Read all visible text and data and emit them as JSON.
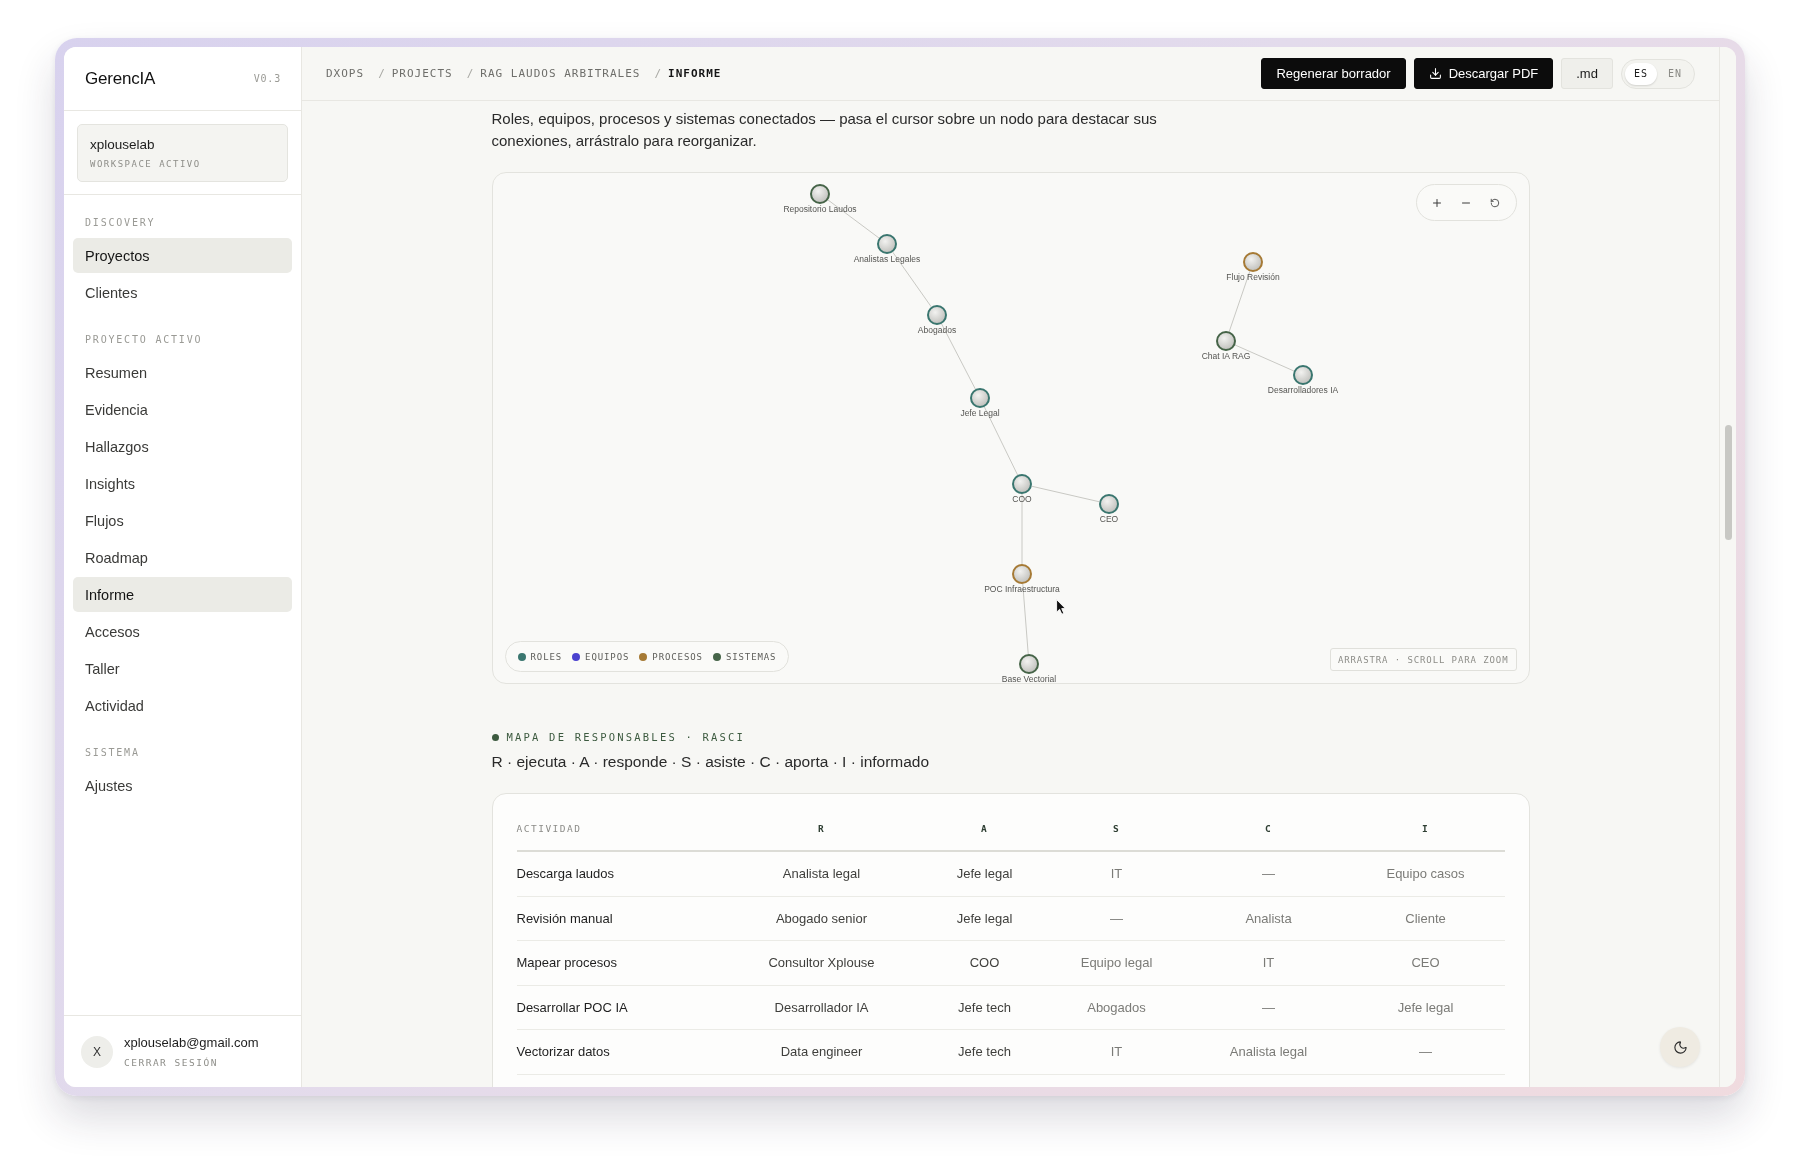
{
  "sidebar": {
    "brand": "GerencIA",
    "version": "V0.3",
    "workspace": {
      "name": "xplouselab",
      "caption": "WORKSPACE ACTIVO"
    },
    "sections": [
      {
        "title": "DISCOVERY",
        "items": [
          {
            "label": "Proyectos",
            "selected": true
          },
          {
            "label": "Clientes",
            "selected": false
          }
        ]
      },
      {
        "title": "PROYECTO ACTIVO",
        "items": [
          {
            "label": "Resumen",
            "selected": false
          },
          {
            "label": "Evidencia",
            "selected": false
          },
          {
            "label": "Hallazgos",
            "selected": false
          },
          {
            "label": "Insights",
            "selected": false
          },
          {
            "label": "Flujos",
            "selected": false
          },
          {
            "label": "Roadmap",
            "selected": false
          },
          {
            "label": "Informe",
            "selected": true
          },
          {
            "label": "Accesos",
            "selected": false
          },
          {
            "label": "Taller",
            "selected": false
          },
          {
            "label": "Actividad",
            "selected": false
          }
        ]
      },
      {
        "title": "SISTEMA",
        "items": [
          {
            "label": "Ajustes",
            "selected": false
          }
        ]
      }
    ],
    "user": {
      "initial": "X",
      "email": "xplouselab@gmail.com",
      "logout": "CERRAR SESIÓN"
    }
  },
  "topbar": {
    "breadcrumbs": [
      {
        "label": "DXOPS",
        "current": false
      },
      {
        "separator": "/",
        "label": "PROJECTS",
        "current": false
      },
      {
        "separator": "/",
        "label": "RAG LAUDOS ARBITRALES",
        "current": false
      },
      {
        "separator": "/",
        "label": "INFORME",
        "current": true
      }
    ],
    "actions": [
      {
        "label": "Regenerar borrador",
        "kind": "primary"
      },
      {
        "label": "Descargar PDF",
        "kind": "download"
      },
      {
        "label": ".md",
        "kind": "secondary"
      }
    ],
    "languages": [
      {
        "label": "ES",
        "selected": true
      },
      {
        "label": "EN",
        "selected": false
      }
    ]
  },
  "graph": {
    "description": "Roles, equipos, procesos y sistemas conectados — pasa el cursor sobre un nodo para destacar sus conexiones, arrástralo para reorganizar.",
    "nodes": [
      {
        "label": "Repositorio Laudos",
        "color": "#466448",
        "children": [
          {
            "label": "Analistas Legales",
            "color": "#3a766f",
            "children": [
              {
                "label": "Abogados",
                "color": "#3a766f",
                "children": [
                  {
                    "label": "Jefe Legal",
                    "color": "#3a766f",
                    "children": [
                      {
                        "label": "COO",
                        "color": "#3a766f",
                        "children": [
                          {
                            "label": "CEO",
                            "color": "#3a766f"
                          },
                          {
                            "label": "POC Infraestructura",
                            "color": "#a67a35",
                            "children": [
                              {
                                "label": "Base Vectorial",
                                "color": "#466448"
                              }
                            ]
                          }
                        ]
                      }
                    ]
                  }
                ]
              }
            ]
          }
        ]
      },
      {
        "label": "Flujo Revisión",
        "color": "#a67a35",
        "children": [
          {
            "label": "Chat IA RAG",
            "color": "#466448",
            "children": [
              {
                "label": "Desarrolladores IA",
                "color": "#3a766f"
              }
            ]
          }
        ]
      }
    ],
    "legend": [
      {
        "label": "ROLES",
        "color": "#3a766f"
      },
      {
        "label": "EQUIPOS",
        "color": "#4b42cf"
      },
      {
        "label": "PROCESOS",
        "color": "#a67a35"
      },
      {
        "label": "SISTEMAS",
        "color": "#466448"
      }
    ],
    "hint": "ARRASTRA · SCROLL PARA ZOOM"
  },
  "rasci": {
    "title": "MAPA DE RESPONSABLES · RASCI",
    "legend": "R · ejecuta · A · responde · S · asiste · C · aporta · I · informado",
    "columns": [
      "ACTIVIDAD",
      "R",
      "A",
      "S",
      "C",
      "I"
    ],
    "rows": [
      [
        "Descarga laudos",
        "Analista legal",
        "Jefe legal",
        "IT",
        "—",
        "Equipo casos"
      ],
      [
        "Revisión manual",
        "Abogado senior",
        "Jefe legal",
        "—",
        "Analista",
        "Cliente"
      ],
      [
        "Mapear procesos",
        "Consultor Xplouse",
        "COO",
        "Equipo legal",
        "IT",
        "CEO"
      ],
      [
        "Desarrollar POC IA",
        "Desarrollador IA",
        "Jefe tech",
        "Abogados",
        "—",
        "Jefe legal"
      ],
      [
        "Vectorizar datos",
        "Data engineer",
        "Jefe tech",
        "IT",
        "Analista legal",
        "—"
      ]
    ]
  }
}
